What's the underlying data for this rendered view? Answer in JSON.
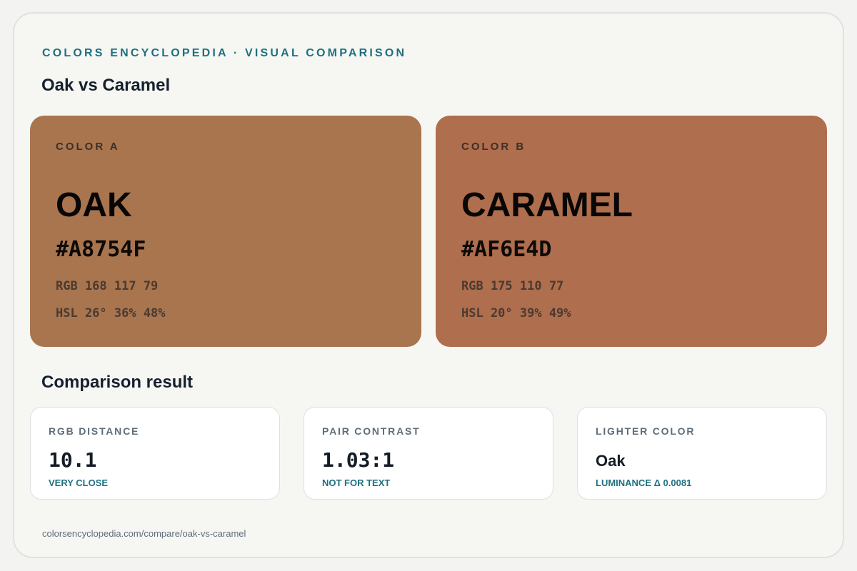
{
  "header": {
    "eyebrow": "COLORS ENCYCLOPEDIA · VISUAL COMPARISON",
    "title": "Oak vs Caramel"
  },
  "colors": [
    {
      "tag": "COLOR A",
      "name": "OAK",
      "hex": "#A8754F",
      "rgb": "RGB 168 117 79",
      "hsl": "HSL 26° 36% 48%",
      "swatch_color": "#A8754F"
    },
    {
      "tag": "COLOR B",
      "name": "CARAMEL",
      "hex": "#AF6E4D",
      "rgb": "RGB 175 110 77",
      "hsl": "HSL 20° 39% 49%",
      "swatch_color": "#AF6E4D"
    }
  ],
  "comparison": {
    "title": "Comparison result",
    "cards": [
      {
        "label": "RGB DISTANCE",
        "value": "10.1",
        "note": "VERY CLOSE"
      },
      {
        "label": "PAIR CONTRAST",
        "value": "1.03:1",
        "note": "NOT FOR TEXT"
      },
      {
        "label": "LIGHTER COLOR",
        "value": "Oak",
        "note": "LUMINANCE Δ 0.0081"
      }
    ]
  },
  "footer": {
    "url": "colorsencyclopedia.com/compare/oak-vs-caramel"
  },
  "theme": {
    "accent": "#1E7080",
    "background": "#F6F7F3"
  }
}
